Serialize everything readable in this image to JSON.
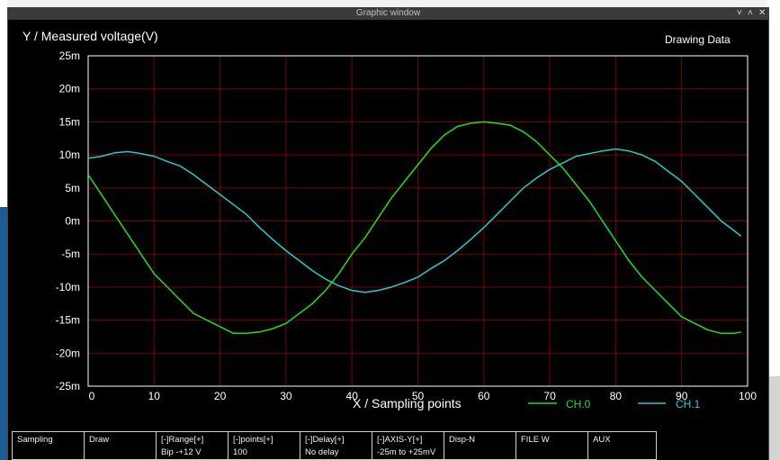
{
  "window": {
    "title": "Graphic window",
    "minimize_glyph": "˅",
    "maximize_glyph": "˄",
    "close_glyph": "✕"
  },
  "header": {
    "ylabel": "Y / Measured voltage(V)",
    "status": "Drawing Data"
  },
  "legend": {
    "entries": [
      {
        "name": "CH.0",
        "color": "#22dd22"
      },
      {
        "name": "CH.1",
        "color": "#22cccc"
      }
    ]
  },
  "buttons": [
    {
      "label": "Sampling",
      "sub": ""
    },
    {
      "label": "Draw",
      "sub": ""
    },
    {
      "label": "[-]Range[+]",
      "sub": "Bip -+12 V"
    },
    {
      "label": "[-]points[+]",
      "sub": "100"
    },
    {
      "label": "[-]Delay[+]",
      "sub": "No delay"
    },
    {
      "label": "[-]AXIS-Y[+]",
      "sub": "-25m to +25mV"
    },
    {
      "label": "Disp-N",
      "sub": ""
    },
    {
      "label": "FILE W",
      "sub": ""
    },
    {
      "label": "AUX",
      "sub": ""
    }
  ],
  "colors": {
    "grid": "#7a0000",
    "axis": "#ffffff",
    "ch0": "#22dd22",
    "ch1": "#22cccc"
  },
  "chart_data": {
    "type": "line",
    "xlabel": "X / Sampling points",
    "ylabel": "Y / Measured voltage(V)",
    "xlim": [
      0,
      100
    ],
    "ylim": [
      -0.025,
      0.025
    ],
    "xticks": [
      "0",
      "10",
      "20",
      "30",
      "40",
      "50",
      "60",
      "70",
      "80",
      "90",
      "100"
    ],
    "yticks": [
      "25m",
      "20m",
      "15m",
      "10m",
      "5m",
      "0m",
      "-5m",
      "-10m",
      "-15m",
      "-20m",
      "-25m"
    ],
    "grid": true,
    "legend_position": "bottom-right",
    "series": [
      {
        "name": "CH.0",
        "x": [
          0,
          2,
          4,
          6,
          8,
          10,
          12,
          14,
          16,
          18,
          20,
          22,
          24,
          26,
          28,
          30,
          32,
          34,
          36,
          38,
          40,
          42,
          44,
          46,
          48,
          50,
          52,
          54,
          56,
          58,
          60,
          62,
          64,
          66,
          68,
          70,
          72,
          74,
          76,
          78,
          80,
          82,
          84,
          86,
          88,
          90,
          92,
          94,
          96,
          98,
          99
        ],
        "y": [
          7,
          4,
          1,
          -2,
          -5,
          -8,
          -10,
          -12,
          -14,
          -15,
          -16,
          -17,
          -17,
          -16.8,
          -16.3,
          -15.5,
          -14,
          -12.5,
          -10.5,
          -8,
          -5,
          -2.5,
          0.5,
          3.5,
          6,
          8.5,
          11,
          13,
          14.3,
          14.8,
          15,
          14.8,
          14.5,
          13.5,
          12,
          10,
          8,
          5.5,
          3,
          0,
          -3,
          -6,
          -8.5,
          -10.5,
          -12.5,
          -14.5,
          -15.5,
          -16.5,
          -17,
          -17,
          -16.8
        ]
      },
      {
        "name": "CH.1",
        "x": [
          0,
          2,
          4,
          6,
          8,
          10,
          12,
          14,
          16,
          18,
          20,
          22,
          24,
          26,
          28,
          30,
          32,
          34,
          36,
          38,
          40,
          42,
          44,
          46,
          48,
          50,
          52,
          54,
          56,
          58,
          60,
          62,
          64,
          66,
          68,
          70,
          72,
          74,
          76,
          78,
          80,
          82,
          84,
          86,
          88,
          90,
          92,
          94,
          96,
          98,
          99
        ],
        "y": [
          9.5,
          9.8,
          10.3,
          10.5,
          10.2,
          9.8,
          9,
          8.3,
          7,
          5.5,
          4,
          2.5,
          1,
          -1,
          -2.8,
          -4.5,
          -6,
          -7.5,
          -8.8,
          -9.8,
          -10.5,
          -10.8,
          -10.5,
          -10,
          -9.3,
          -8.5,
          -7.2,
          -6,
          -4.5,
          -2.8,
          -1,
          1,
          3,
          5,
          6.5,
          7.8,
          8.8,
          9.8,
          10.2,
          10.6,
          10.9,
          10.6,
          10,
          9,
          7.5,
          6,
          4,
          2,
          0,
          -1.5,
          -2.3
        ]
      }
    ]
  }
}
